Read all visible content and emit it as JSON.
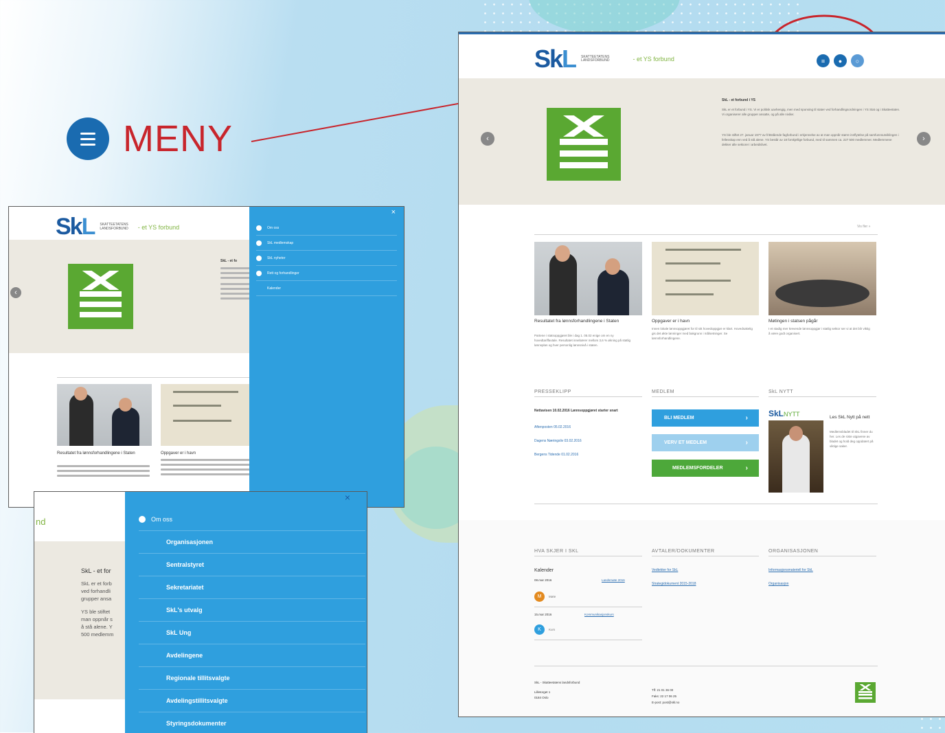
{
  "meny": {
    "label": "MENY"
  },
  "big": {
    "logo": {
      "sk": "Sk",
      "l": "L",
      "sub1": "SKATTEETATENS",
      "sub2": "LANDSFORBUND",
      "ys": "- et YS forbund"
    },
    "hero": {
      "title": "SkL - et forbund i YS",
      "p1": "SkL er et forbund i YS. Vi er politisk uavhengig, men med sponsing til stater ved forhandlingsordningen i YS Stat og i Skatteetaten. Vi organiserer alle grupper ansatte, og på alle nivåer.",
      "p2": "YS ble stiftet 27. januar 1977 av frittstående fagforbund i erkjennelse av at man oppnår større innflytelse på samfunnsutviklingen i fellesskap enn ved å stå alene. YS består av 18 forskjellige forbund, med til sammen ca. 227 500 medlemmer. Medlemmene dekker alle sektorer i arbeidslivet."
    },
    "more": "Vis fler »",
    "news": [
      {
        "title": "Resultatet fra lønnsforhandlingene i Staten",
        "body": "Partene i statsoppgjøret ble i dag 1. 05.02 enige om en ny hovedtariffavtale. Resultatet innebærer mellom 3,6 % økning på statlig lønnsplan og hver personlig lønnsnivå i staten."
      },
      {
        "title": "Oppgaver er i havn",
        "body": "Innen lokale lønnsoppgjøret for til sitt hovedoppgjør er klart. Hovedsakelig gis det økte lønninger med bakgrunn i målsetninger. Se lønnsforhandlingene."
      },
      {
        "title": "Møtingen i statsen pågår",
        "body": "I et stadig mer krevende lønnsoppgjør i statlig sektor ser vi at det blir viktig å være godt organisert."
      }
    ],
    "sections": {
      "press": "PRESSEKLIPP",
      "member": "MEDLEM",
      "nytt": "SkL NYTT",
      "kalender": "HVA SKJER I SKL",
      "avtaler": "AVTALER/DOKUMENTER",
      "org": "ORGANISASJONEN"
    },
    "press_items": [
      "Nettavisen 10.02.2016 Lønnsoppgjøret starter snart",
      "Aftenposten 05.02.2016",
      "Dagens Næringsliv 03.02.2016",
      "Bergens Tidende 01.02.2016"
    ],
    "buttons": {
      "b1": "BLI MEDLEM",
      "b2": "VERV ET MEDLEM",
      "b3": "MEDLEMSFORDELER"
    },
    "nytt": {
      "logo_sk": "SkL",
      "logo_nytt": "NYTT",
      "title": "Les SkL Nytt på nett",
      "body": "Medlemsbladet til SkL finner du her. Les de siste utgavene av bladet og hold deg oppdatert på viktige saker."
    },
    "kalender": {
      "label": "Kalender",
      "d1": "08.mar 2016",
      "d1link": "Landsmøte 2016",
      "d1txt": "Møte",
      "d2": "15.mar 2016",
      "d2link": "Kommunikasjonskurs",
      "d2txt": "Kurs"
    },
    "avtaler_links": [
      "Vedtekter for SkL",
      "Strategidokument 2015-2018"
    ],
    "org_links": [
      "Informasjonsmateriell for SkL",
      "Organisasjon"
    ],
    "footer": {
      "name": "SkL - Skatteetatens landsforbund",
      "addr1": "Lilletorget 1",
      "addr2": "0184 Oslo",
      "tlf": "Tlf: 21 01 36 00",
      "fax": "Faks: 22 17 06 25",
      "epost": "E-post: post@skl.no"
    }
  },
  "lup": {
    "logo": {
      "sk": "Sk",
      "l": "L",
      "sub1": "SKATTEETATENS",
      "sub2": "LANDSFORBUND",
      "ys": "- et YS forbund"
    },
    "hero_title": "SkL - et fo",
    "menu": [
      "Om oss",
      "SkL medlemskap",
      "SkL nyheter",
      "Rett og forhandlinger",
      "Kalender"
    ],
    "close": "×",
    "news": [
      {
        "title": "Resultatet fra lønnsforhandlingene i Staten"
      },
      {
        "title": "Oppgaver er i havn"
      }
    ]
  },
  "llow": {
    "partial": "nd",
    "hero_title": "SkL - et for",
    "hero_lines": [
      "SkL er et forb",
      "ved forhandli",
      "grupper ansa"
    ],
    "hero_lines2": [
      "YS ble stiftet",
      "man oppnår s",
      "å stå alene. Y",
      "500 medlemm"
    ],
    "close": "×",
    "menu_head": "Om oss",
    "menu": [
      "Organisasjonen",
      "Sentralstyret",
      "Sekretariatet",
      "SkL's utvalg",
      "SkL Ung",
      "Avdelingene",
      "Regionale tillitsvalgte",
      "Avdelingstillitsvalgte",
      "Styringsdokumenter"
    ]
  }
}
